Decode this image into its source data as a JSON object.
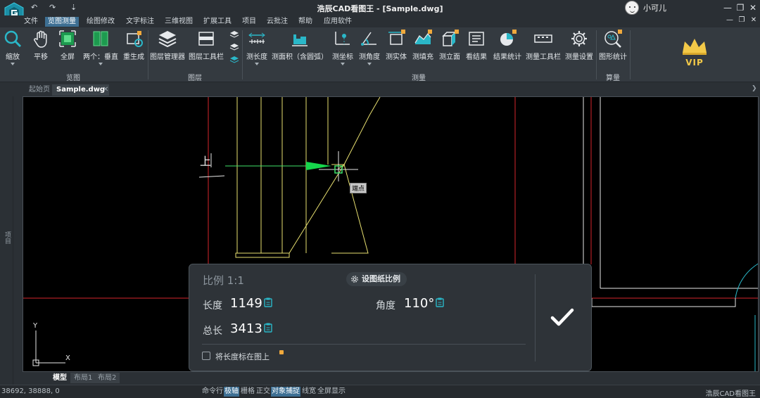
{
  "titlebar": {
    "title": "浩辰CAD看图王 - [Sample.dwg]",
    "quick_access": [
      "↶",
      "↷",
      "⇣"
    ],
    "user_name": "小可儿",
    "window_controls": [
      "—",
      "❐",
      "✕"
    ],
    "doc_controls": [
      "—",
      "❐",
      "✕"
    ]
  },
  "menu": {
    "items": [
      "文件",
      "览图测量",
      "绘图修改",
      "文字标注",
      "三维视图",
      "扩展工具",
      "项目",
      "云批注",
      "帮助",
      "应用软件"
    ],
    "active_index": 1
  },
  "ribbon": {
    "groups": [
      {
        "label": "览图",
        "tools": [
          "缩放",
          "平移",
          "全屏",
          "两个：垂直",
          "重生成"
        ]
      },
      {
        "label": "图层",
        "tools": [
          "图层管理器",
          "图层工具栏"
        ]
      },
      {
        "label": "测量",
        "tools": [
          "测长度",
          "测面积（含圆弧）",
          "测坐标",
          "测角度",
          "测实体",
          "测填充",
          "测立面",
          "看结果",
          "结果统计",
          "测量工具栏",
          "测量设置"
        ]
      },
      {
        "label": "算量",
        "tools": [
          "图形统计"
        ]
      }
    ],
    "vip_label": "VIP",
    "accent_color": "#2ab7c8",
    "badge_color": "#f0a93c"
  },
  "doc_tabs": {
    "items": [
      "起始页",
      "Sample.dwg"
    ],
    "active_index": 1,
    "close_glyph": "✕"
  },
  "left_dock": {
    "label": "项目"
  },
  "canvas": {
    "snap_tooltip": "端点",
    "up_label": "上",
    "ucs_x": "X",
    "ucs_y": "Y"
  },
  "measure_panel": {
    "scale_text": "比例 1:1",
    "set_scale_button": "设图纸比例",
    "length_label": "长度",
    "length_value": "1149",
    "angle_label": "角度",
    "angle_value": "110°",
    "total_label": "总长",
    "total_value": "3413",
    "mark_on_drawing_label": "将长度标在图上",
    "mark_on_drawing_checked": false
  },
  "layout_tabs": {
    "items": [
      "模型",
      "布局1",
      "布局2"
    ],
    "active_index": 0
  },
  "statusbar": {
    "coords": "38692, 38888, 0",
    "toggles": [
      {
        "label": "命令行",
        "on": false
      },
      {
        "label": "极轴",
        "on": true
      },
      {
        "label": "栅格",
        "on": false
      },
      {
        "label": "正交",
        "on": false
      },
      {
        "label": "对象捕捉",
        "on": true
      },
      {
        "label": "线宽",
        "on": false
      },
      {
        "label": "全屏显示",
        "on": false
      }
    ],
    "brand": "浩辰CAD看图王"
  }
}
